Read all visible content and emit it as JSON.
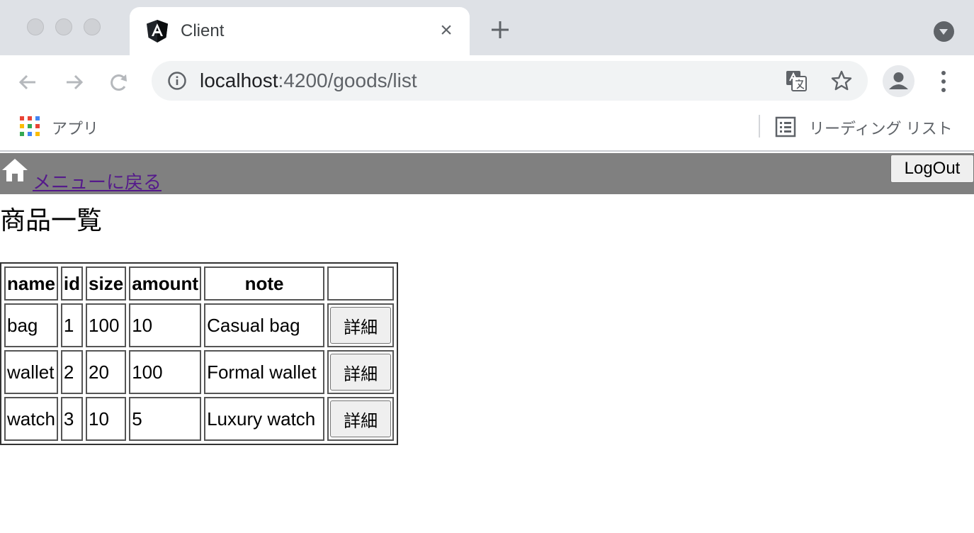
{
  "browser": {
    "tab_title": "Client",
    "tab_close_glyph": "×",
    "url_host": "localhost",
    "url_rest": ":4200/goods/list",
    "bookmarks": {
      "apps_label": "アプリ",
      "reading_list_label": "リーディング リスト"
    },
    "icons": [
      "angular-favicon-icon",
      "new-tab-icon",
      "tab-search-icon",
      "back-icon",
      "forward-icon",
      "reload-icon",
      "info-icon",
      "translate-icon",
      "star-icon",
      "profile-icon",
      "kebab-menu-icon",
      "apps-grid-icon",
      "reading-list-icon"
    ]
  },
  "header": {
    "menu_link": "メニューに戻る",
    "logout_label": "LogOut",
    "background": "#808080"
  },
  "page": {
    "title": "商品一覧"
  },
  "table": {
    "columns": [
      "name",
      "id",
      "size",
      "amount",
      "note",
      ""
    ],
    "rows": [
      {
        "name": "bag",
        "id": "1",
        "size": "100",
        "amount": "10",
        "note": "Casual bag",
        "action": "詳細"
      },
      {
        "name": "wallet",
        "id": "2",
        "size": "20",
        "amount": "100",
        "note": "Formal wallet",
        "action": "詳細"
      },
      {
        "name": "watch",
        "id": "3",
        "size": "10",
        "amount": "5",
        "note": "Luxury watch",
        "action": "詳細"
      }
    ]
  }
}
